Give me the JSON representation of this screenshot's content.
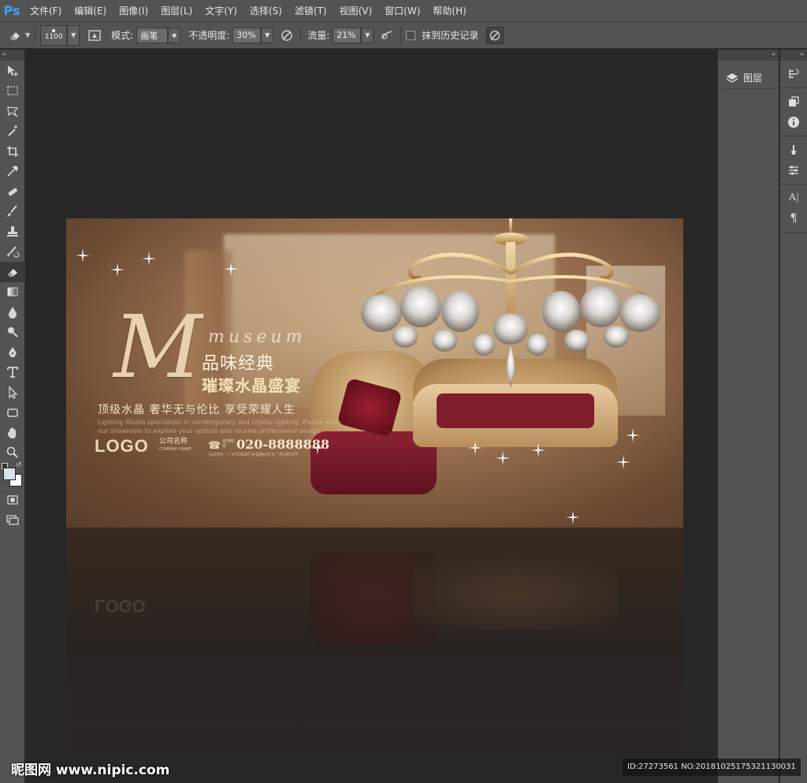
{
  "app": {
    "logo": "Ps"
  },
  "menu": [
    "文件(F)",
    "编辑(E)",
    "图像(I)",
    "图层(L)",
    "文字(Y)",
    "选择(S)",
    "滤镜(T)",
    "视图(V)",
    "窗口(W)",
    "帮助(H)"
  ],
  "options": {
    "brush_size": "1100",
    "mode_label": "模式:",
    "mode_value": "画笔",
    "opacity_label": "不透明度:",
    "opacity_value": "30%",
    "flow_label": "流量:",
    "flow_value": "21%",
    "erase_history_label": "抹到历史记录"
  },
  "panels": {
    "layers_label": "图层"
  },
  "artwork": {
    "big_letter": "M",
    "script_word": "museum",
    "headline1": "品味经典",
    "headline2": "璀璨水晶盛宴",
    "subtitle": "顶级水晶  奢华无与伦比  享受荣耀人生",
    "english_line1": "Lighting Studio specializes in contemporary and crystal lighting. Please visit",
    "english_line2": "our showroom to explore your options and receive professional design",
    "logo": "LOGO",
    "company_name": "公司名称",
    "company_name_en": "COMPANY NAME",
    "phone_label": "咨询热线",
    "phone": "020-8888888",
    "address": "活动地址：广州市海珠区幸福路旧文化广场3楼31号"
  },
  "watermark": {
    "left": "昵图网 www.nipic.com",
    "right": "ID:27273561 NO:20181025175321130031"
  }
}
